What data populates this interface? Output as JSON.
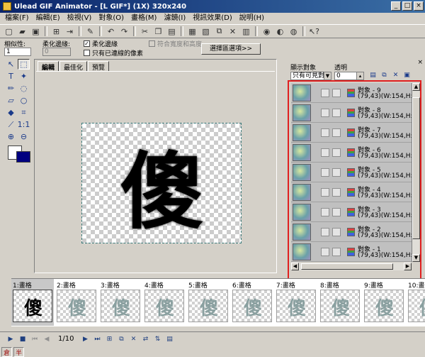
{
  "window": {
    "title": "Ulead GIF Animator - [L GIF*] (1X) 320x240",
    "controls": [
      "_",
      "□",
      "×"
    ]
  },
  "menu": [
    "檔案(F)",
    "編輯(E)",
    "檢視(V)",
    "對象(O)",
    "畫格(M)",
    "濾鏡(I)",
    "視訊效果(D)",
    "說明(H)"
  ],
  "attributes": {
    "similarity_label": "相似性:",
    "similarity_value": "1",
    "feather_label": "柔化邊緣:",
    "feather_value": "0",
    "antialias_label": "柔化邊緣",
    "antialias_checked": true,
    "contiguous_label": "只有已連線的像素",
    "contiguous_checked": false,
    "fit_label": "符合寬度和高度",
    "fit_checked": false,
    "selection_button": "選擇區選項>>"
  },
  "work": {
    "tabs": [
      "編輯",
      "最佳化",
      "預覽"
    ],
    "active_tab": "編輯",
    "canvas_glyph": "傻"
  },
  "panel": {
    "show_objects_label": "顯示對象",
    "opacity_label": "透明",
    "show_filter": "只有可見對",
    "opacity_value": "0",
    "objects": [
      {
        "name": "對象 - 9",
        "info": "(79,43)(W:154,H:152"
      },
      {
        "name": "對象 - 8",
        "info": "(79,43)(W:154,H:152"
      },
      {
        "name": "對象 - 7",
        "info": "(79,43)(W:154,H:152"
      },
      {
        "name": "對象 - 6",
        "info": "(79,43)(W:154,H:152"
      },
      {
        "name": "對象 - 5",
        "info": "(79,43)(W:154,H:152"
      },
      {
        "name": "對象 - 4",
        "info": "(79,43)(W:154,H:152"
      },
      {
        "name": "對象 - 3",
        "info": "(79,43)(W:154,H:152"
      },
      {
        "name": "對象 - 2",
        "info": "(79,43)(W:154,H:152"
      },
      {
        "name": "對象 - 1",
        "info": "(79,43)(W:154,H:152"
      }
    ]
  },
  "frames": [
    {
      "label": "1:畫格",
      "glyph": "傻",
      "selected": true
    },
    {
      "label": "2:畫格",
      "glyph": "傻",
      "selected": false
    },
    {
      "label": "3:畫格",
      "glyph": "傻",
      "selected": false
    },
    {
      "label": "4:畫格",
      "glyph": "傻",
      "selected": false
    },
    {
      "label": "5:畫格",
      "glyph": "傻",
      "selected": false
    },
    {
      "label": "6:畫格",
      "glyph": "傻",
      "selected": false
    },
    {
      "label": "7:畫格",
      "glyph": "傻",
      "selected": false
    },
    {
      "label": "8:畫格",
      "glyph": "傻",
      "selected": false
    },
    {
      "label": "9:畫格",
      "glyph": "傻",
      "selected": false
    },
    {
      "label": "10:畫格",
      "glyph": "傻",
      "selected": false
    }
  ],
  "playback": {
    "frame_counter": "1/10"
  },
  "status": [
    "倉",
    "半"
  ],
  "colors": {
    "highlight": "#e02020",
    "background_swatch": "#000080",
    "title_gradient_start": "#0a246a"
  }
}
